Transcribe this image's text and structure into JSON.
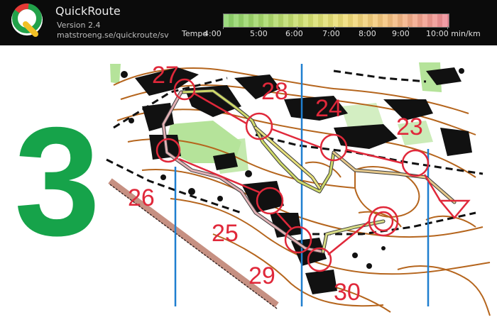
{
  "app": {
    "name": "QuickRoute",
    "version": "Version 2.4",
    "url": "matstroeng.se/quickroute/sv"
  },
  "pace_legend": {
    "title": "Tempo",
    "labels": [
      "4:00",
      "5:00",
      "6:00",
      "7:00",
      "8:00",
      "9:00",
      "10:00 min/km"
    ],
    "colors": [
      "#8bd36b",
      "#d5e070",
      "#f1dc77",
      "#f4c37c",
      "#ee8a98"
    ]
  },
  "map": {
    "leg_number": "3",
    "controls": [
      "27",
      "28",
      "24",
      "23",
      "26",
      "25",
      "29",
      "30"
    ],
    "colors": {
      "contour": "#b5651d",
      "vegetation": "#a8e08c",
      "course": "#e0283a",
      "north_lines": "#1f7fd0",
      "route": "#c8d66a",
      "leg_number": "#16a34a"
    }
  },
  "icons": {
    "logo": "quickroute-logo-icon"
  }
}
